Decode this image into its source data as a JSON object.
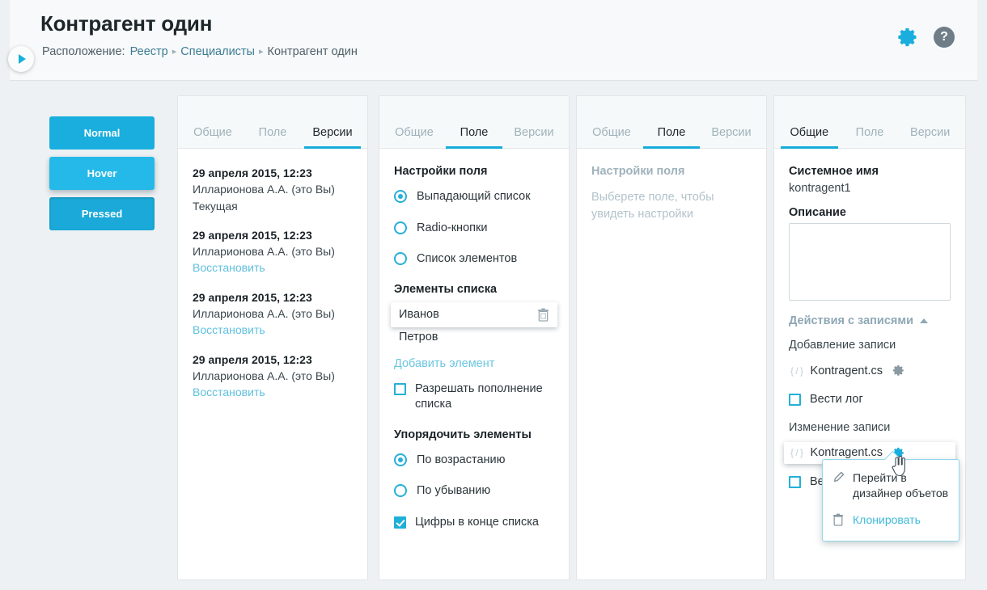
{
  "header": {
    "title": "Контрагент один",
    "breadcrumb_label": "Расположение:",
    "breadcrumb": [
      "Реестр",
      "Специалисты",
      "Контрагент один"
    ],
    "separator": "▸",
    "gear_icon": "gear-icon",
    "help_icon": "help-icon",
    "help_glyph": "?"
  },
  "collapse_button": {
    "icon": "play-triangle-icon"
  },
  "button_states": [
    {
      "label": "Normal",
      "state": "normal"
    },
    {
      "label": "Hover",
      "state": "hover"
    },
    {
      "label": "Pressed",
      "state": "pressed"
    }
  ],
  "colors": {
    "accent": "#19aede",
    "accent_light": "#24b9e8",
    "link": "#5fc0de",
    "muted": "#9fb2bb",
    "text": "#1b2327"
  },
  "panels": [
    {
      "id": "panel-versions",
      "tabs": [
        {
          "label": "Общие",
          "active": false
        },
        {
          "label": "Поле",
          "active": false
        },
        {
          "label": "Версии",
          "active": true
        }
      ],
      "versions": [
        {
          "date": "29 апреля 2015, 12:23",
          "author": "Илларионова А.А. (это Вы)",
          "state": "Текущая",
          "action": ""
        },
        {
          "date": "29 апреля 2015, 12:23",
          "author": "Илларионова А.А. (это Вы)",
          "state": "",
          "action": "Восстановить"
        },
        {
          "date": "29 апреля 2015, 12:23",
          "author": "Илларионова А.А. (это Вы)",
          "state": "",
          "action": "Восстановить"
        },
        {
          "date": "29 апреля 2015, 12:23",
          "author": "Илларионова А.А. (это Вы)",
          "state": "",
          "action": "Восстановить"
        }
      ]
    },
    {
      "id": "panel-field-settings",
      "tabs": [
        {
          "label": "Общие",
          "active": false
        },
        {
          "label": "Поле",
          "active": true
        },
        {
          "label": "Версии",
          "active": false
        }
      ],
      "settings_title": "Настройки поля",
      "type_options": [
        {
          "label": "Выпадающий список",
          "selected": true
        },
        {
          "label": "Radio-кнопки",
          "selected": false
        },
        {
          "label": "Список элементов",
          "selected": false
        }
      ],
      "list_title": "Элементы списка",
      "list_items": [
        {
          "label": "Иванов",
          "hovered": true,
          "delete_icon": "trash-icon"
        },
        {
          "label": "Петров",
          "hovered": false
        }
      ],
      "add_item_link": "Добавить элемент",
      "allow_extend": {
        "label": "Разрешать пополнение списка",
        "checked": false
      },
      "order_title": "Упорядочить элементы",
      "order_options": [
        {
          "label": "По возрастанию",
          "selected": true
        },
        {
          "label": "По убыванию",
          "selected": false
        }
      ],
      "digits_last": {
        "label": "Цифры в конце списка",
        "checked": true
      }
    },
    {
      "id": "panel-field-empty",
      "tabs": [
        {
          "label": "Общие",
          "active": false
        },
        {
          "label": "Поле",
          "active": true
        },
        {
          "label": "Версии",
          "active": false
        }
      ],
      "settings_title": "Настройки поля",
      "empty_hint": "Выберете поле, чтобы увидеть настройки"
    },
    {
      "id": "panel-general",
      "tabs": [
        {
          "label": "Общие",
          "active": true
        },
        {
          "label": "Поле",
          "active": false
        },
        {
          "label": "Версии",
          "active": false
        }
      ],
      "system_name_label": "Системное имя",
      "system_name_value": "kontragent1",
      "description_label": "Описание",
      "description_value": "",
      "accordion_title": "Действия с записями",
      "accordion_caret": "caret-up-icon",
      "add_record_label": "Добавление записи",
      "add_record_script": {
        "icon": "code-icon",
        "icon_glyph": "{ / }",
        "name": "Kontragent.cs",
        "gear": "gear-icon",
        "hovered": false
      },
      "add_record_log": {
        "label": "Вести лог",
        "checked": false
      },
      "edit_record_label": "Изменение записи",
      "edit_record_script": {
        "icon": "code-icon",
        "icon_glyph": "{ / }",
        "name": "Kontragent.cs",
        "gear": "gear-icon",
        "hovered": true
      },
      "edit_record_log": {
        "label": "Вести лог",
        "checked": false
      }
    }
  ],
  "context_menu": {
    "items": [
      {
        "label": "Перейти в дизайнер объетов",
        "icon": "pencil-icon",
        "style": "dark"
      },
      {
        "label": "Клонировать",
        "icon": "trash-icon",
        "style": "cyan"
      }
    ]
  }
}
